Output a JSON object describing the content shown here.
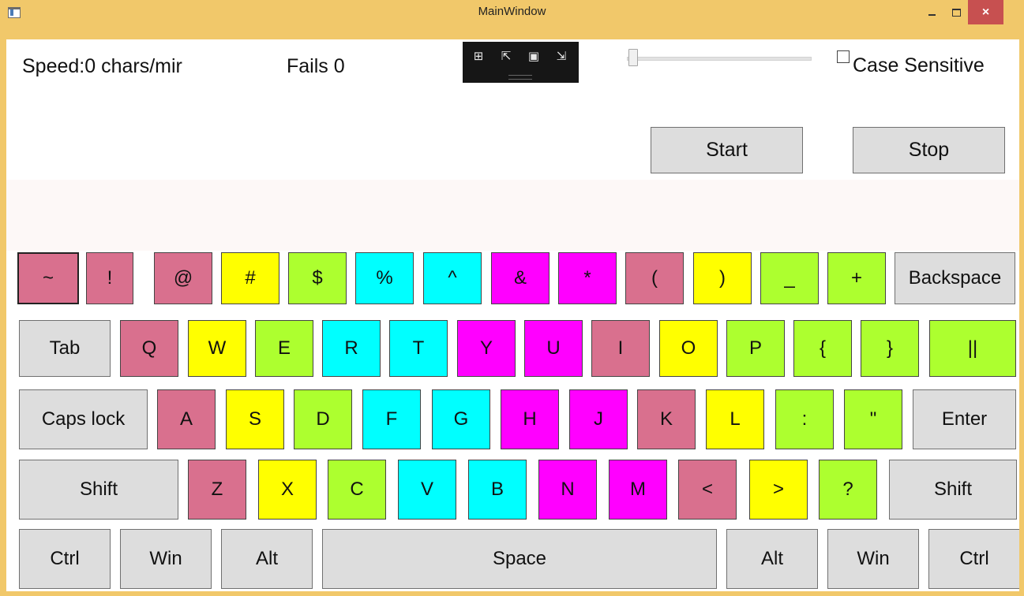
{
  "window": {
    "title": "MainWindow",
    "minimize_icon": "minimize-icon",
    "maximize_icon": "maximize-icon",
    "close_label": "×"
  },
  "stats": {
    "speed": "Speed:0 chars/mir",
    "fails": "Fails 0"
  },
  "devtools": {
    "icons": [
      "live-visual-tree-icon",
      "select-element-icon",
      "display-layout-adorners-icon",
      "track-focused-element-icon"
    ],
    "glyphs": [
      "⊞",
      "⇱",
      "▣",
      "⇲"
    ]
  },
  "slider": {
    "value": 0
  },
  "options": {
    "case_sensitive_label": "Case Sensitive",
    "case_sensitive_checked": false
  },
  "controls": {
    "start_label": "Start",
    "stop_label": "Stop"
  },
  "colors": {
    "pink": "#d9708e",
    "yellow": "#ffff00",
    "green": "#adff2f",
    "cyan": "#00ffff",
    "magenta": "#ff00ff",
    "gray": "#dddddd"
  },
  "keyboard": {
    "rows": [
      [
        {
          "label": "~",
          "color": "pink"
        },
        {
          "label": "!",
          "color": "pink"
        },
        {
          "label": "@",
          "color": "pink"
        },
        {
          "label": "#",
          "color": "yellow"
        },
        {
          "label": "$",
          "color": "green"
        },
        {
          "label": "%",
          "color": "cyan"
        },
        {
          "label": "^",
          "color": "cyan"
        },
        {
          "label": "&",
          "color": "magenta"
        },
        {
          "label": "*",
          "color": "magenta"
        },
        {
          "label": "(",
          "color": "pink"
        },
        {
          "label": ")",
          "color": "yellow"
        },
        {
          "label": "_",
          "color": "green"
        },
        {
          "label": "+",
          "color": "green"
        },
        {
          "label": "Backspace",
          "color": "gray"
        }
      ],
      [
        {
          "label": "Tab",
          "color": "gray"
        },
        {
          "label": "Q",
          "color": "pink"
        },
        {
          "label": "W",
          "color": "yellow"
        },
        {
          "label": "E",
          "color": "green"
        },
        {
          "label": "R",
          "color": "cyan"
        },
        {
          "label": "T",
          "color": "cyan"
        },
        {
          "label": "Y",
          "color": "magenta"
        },
        {
          "label": "U",
          "color": "magenta"
        },
        {
          "label": "I",
          "color": "pink"
        },
        {
          "label": "O",
          "color": "yellow"
        },
        {
          "label": "P",
          "color": "green"
        },
        {
          "label": "{",
          "color": "green"
        },
        {
          "label": "}",
          "color": "green"
        },
        {
          "label": "||",
          "color": "green"
        }
      ],
      [
        {
          "label": "Caps lock",
          "color": "gray"
        },
        {
          "label": "A",
          "color": "pink"
        },
        {
          "label": "S",
          "color": "yellow"
        },
        {
          "label": "D",
          "color": "green"
        },
        {
          "label": "F",
          "color": "cyan"
        },
        {
          "label": "G",
          "color": "cyan"
        },
        {
          "label": "H",
          "color": "magenta"
        },
        {
          "label": "J",
          "color": "magenta"
        },
        {
          "label": "K",
          "color": "pink"
        },
        {
          "label": "L",
          "color": "yellow"
        },
        {
          "label": ":",
          "color": "green"
        },
        {
          "label": "\"",
          "color": "green"
        },
        {
          "label": "Enter",
          "color": "gray"
        }
      ],
      [
        {
          "label": "Shift",
          "color": "gray"
        },
        {
          "label": "Z",
          "color": "pink"
        },
        {
          "label": "X",
          "color": "yellow"
        },
        {
          "label": "C",
          "color": "green"
        },
        {
          "label": "V",
          "color": "cyan"
        },
        {
          "label": "B",
          "color": "cyan"
        },
        {
          "label": "N",
          "color": "magenta"
        },
        {
          "label": "M",
          "color": "magenta"
        },
        {
          "label": "<",
          "color": "pink"
        },
        {
          "label": ">",
          "color": "yellow"
        },
        {
          "label": "?",
          "color": "green"
        },
        {
          "label": "Shift",
          "color": "gray"
        }
      ],
      [
        {
          "label": "Ctrl",
          "color": "gray"
        },
        {
          "label": "Win",
          "color": "gray"
        },
        {
          "label": "Alt",
          "color": "gray"
        },
        {
          "label": "Space",
          "color": "gray"
        },
        {
          "label": "Alt",
          "color": "gray"
        },
        {
          "label": "Win",
          "color": "gray"
        },
        {
          "label": "Ctrl",
          "color": "gray"
        }
      ]
    ]
  }
}
